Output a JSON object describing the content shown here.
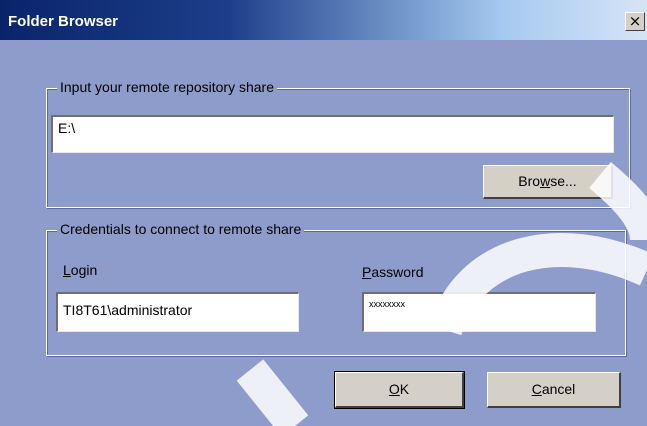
{
  "window": {
    "title": "Folder Browser",
    "close_glyph": "×"
  },
  "repository_group": {
    "legend": "Input your remote repository share",
    "path_value": "E:\\",
    "browse_pre": "Bro",
    "browse_accel": "w",
    "browse_post": "se..."
  },
  "credentials_group": {
    "legend": "Credentials to connect to remote share",
    "login_accel": "L",
    "login_rest": "ogin",
    "login_value": "TI8T61\\administrator",
    "password_accel": "P",
    "password_rest": "assword",
    "password_value": "xxxxxxxx"
  },
  "buttons": {
    "ok_accel": "O",
    "ok_rest": "K",
    "cancel_accel": "C",
    "cancel_rest": "ancel"
  },
  "colors": {
    "dialog_background": "#8e9ccb",
    "titlebar_start": "#0a246a",
    "titlebar_end": "#d6e4f7",
    "button_face": "#d4d0c8"
  }
}
